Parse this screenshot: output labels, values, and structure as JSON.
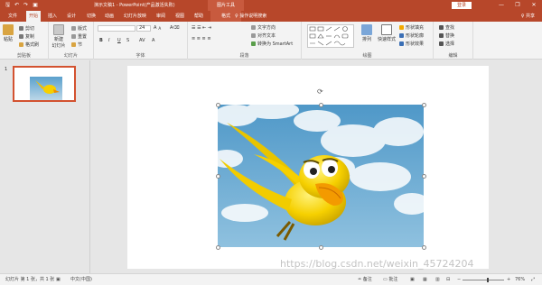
{
  "titlebar": {
    "save_icon": "save-icon",
    "undo_icon": "undo-icon",
    "redo_icon": "redo-icon",
    "present_icon": "slideshow-icon",
    "title": "演示文稿1 - PowerPoint(产品激活失败)",
    "context_tool": "图片工具",
    "login": "登录",
    "min": "—",
    "restore": "❐",
    "close": "✕"
  },
  "tabs": {
    "file": "文件",
    "home": "开始",
    "insert": "插入",
    "design": "设计",
    "transitions": "切换",
    "animations": "动画",
    "slideshow": "幻灯片放映",
    "review": "审阅",
    "view": "视图",
    "help": "帮助",
    "format": "格式",
    "tellme": "♀ 操作说明搜索",
    "share": "♀ 共享"
  },
  "ribbon": {
    "clipboard": {
      "paste": "粘贴",
      "cut": "剪切",
      "copy": "复制",
      "format_painter": "格式刷",
      "label": "剪贴板"
    },
    "slides": {
      "new_slide": "新建 幻灯片",
      "layout": "版式",
      "reset": "重置",
      "section": "节",
      "label": "幻灯片"
    },
    "font": {
      "font_size": "24",
      "bold": "B",
      "italic": "I",
      "underline": "U",
      "strike": "S",
      "label": "字体"
    },
    "paragraph": {
      "text_direction": "文字方向",
      "align_text": "对齐文本",
      "smartart": "转换为 SmartArt",
      "label": "段落"
    },
    "drawing": {
      "arrange": "排列",
      "quick_styles": "快速样式",
      "fill": "形状填充",
      "outline": "形状轮廓",
      "effects": "形状效果",
      "label": "绘图"
    },
    "editing": {
      "find": "查找",
      "replace": "替换",
      "select": "选择",
      "label": "编辑"
    }
  },
  "thumbnail": {
    "number": "1"
  },
  "status": {
    "slide_info": "幻灯片 第 1 张，共 1 张",
    "language": "中文(中国)",
    "notes": "备注",
    "comments": "批注",
    "zoom": "76%",
    "zoom_fraction": 0.62
  },
  "watermark": "https://blog.csdn.net/weixin_45724204",
  "colors": {
    "accent": "#b7472a",
    "sky": "#5aa0cc",
    "bird": "#f6d000"
  }
}
